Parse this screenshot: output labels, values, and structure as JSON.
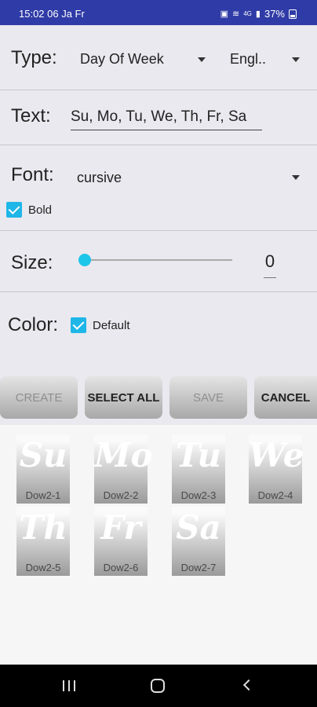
{
  "status_bar": {
    "time": "15:02 06 Ja Fr",
    "icons": [
      "notification-icon",
      "wifi-icon",
      "signal-icon"
    ],
    "network": "4G",
    "battery": "37%"
  },
  "type_row": {
    "label": "Type:",
    "value": "Day Of Week",
    "language": "Engl.."
  },
  "text_row": {
    "label": "Text:",
    "value": "Su, Mo, Tu, We, Th, Fr, Sa"
  },
  "font_row": {
    "label": "Font:",
    "value": "cursive",
    "bold_label": "Bold",
    "bold_checked": true
  },
  "size_row": {
    "label": "Size:",
    "value": "0",
    "slider_value": 0
  },
  "color_row": {
    "label": "Color:",
    "default_label": "Default",
    "default_checked": true
  },
  "buttons": {
    "create": "CREATE",
    "select_all": "SELECT ALL",
    "save": "SAVE",
    "cancel": "CANCEL"
  },
  "tiles": [
    {
      "glyph": "Su",
      "name": "Dow2-1"
    },
    {
      "glyph": "Mo",
      "name": "Dow2-2"
    },
    {
      "glyph": "Tu",
      "name": "Dow2-3"
    },
    {
      "glyph": "We",
      "name": "Dow2-4"
    },
    {
      "glyph": "Th",
      "name": "Dow2-5"
    },
    {
      "glyph": "Fr",
      "name": "Dow2-6"
    },
    {
      "glyph": "Sa",
      "name": "Dow2-7"
    }
  ],
  "colors": {
    "status_bar": "#2f3ba6",
    "accent": "#1fb6e8",
    "background": "#e9e9ef"
  }
}
